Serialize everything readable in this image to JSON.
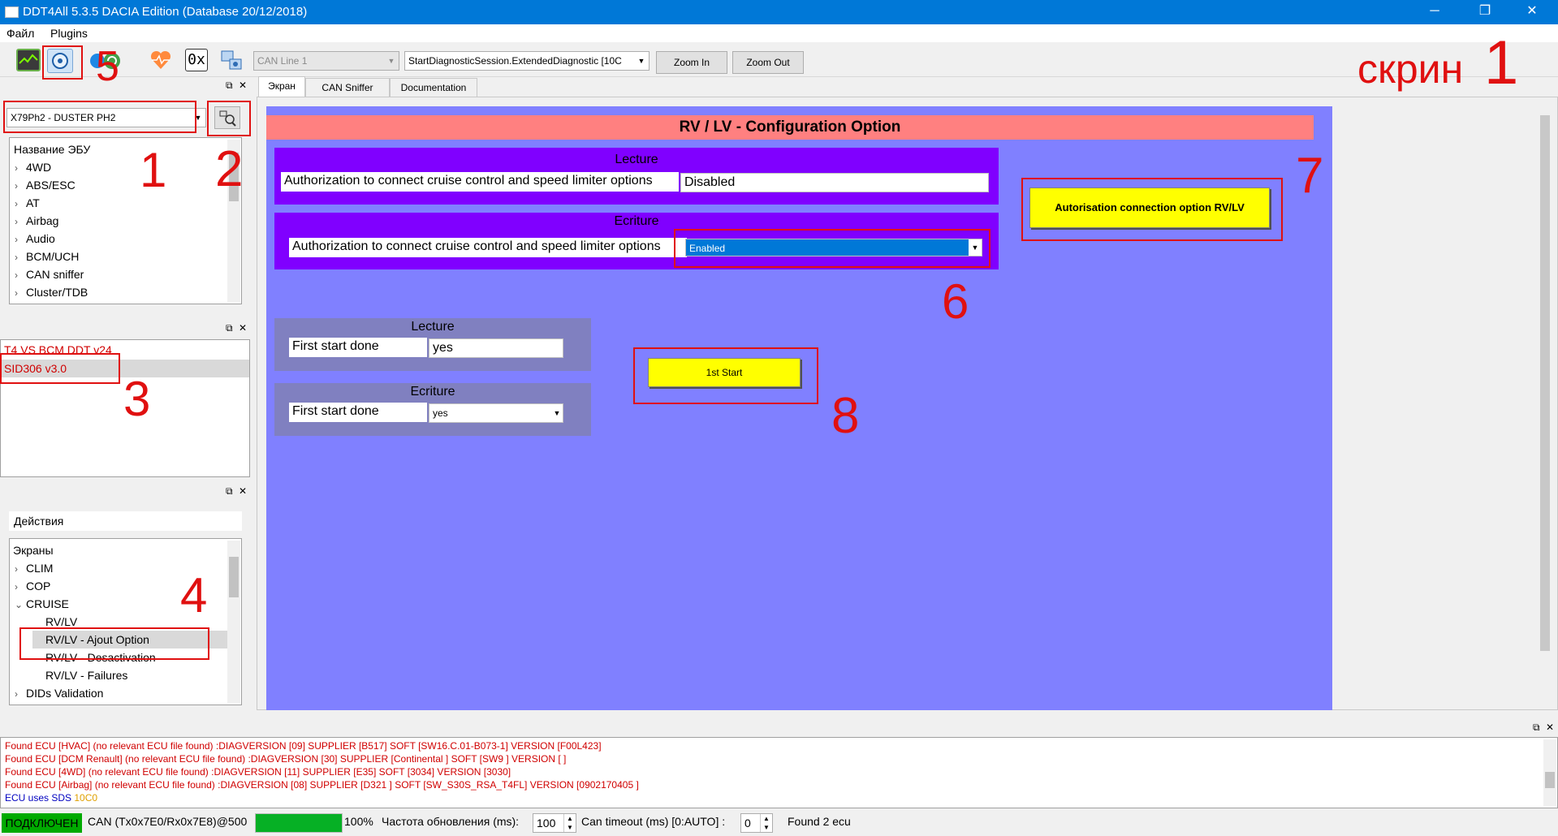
{
  "window": {
    "title": "DDT4All 5.3.5 DACIA Edition (Database 20/12/2018)",
    "minimize": "─",
    "maximize": "❐",
    "close": "✕"
  },
  "menu": {
    "file": "Файл",
    "plugins": "Plugins"
  },
  "toolbar": {
    "can_line": "CAN Line 1",
    "session": "StartDiagnosticSession.ExtendedDiagnostic [10C",
    "zoom_in": "Zoom In",
    "zoom_out": "Zoom Out",
    "hex_icon_text": "0x"
  },
  "vehicle": {
    "selected": "X79Ph2 - DUSTER PH2"
  },
  "ecu_tree": {
    "header": "Название ЭБУ",
    "items": [
      "4WD",
      "ABS/ESC",
      "AT",
      "Airbag",
      "Audio",
      "BCM/UCH",
      "CAN sniffer",
      "Cluster/TDB"
    ]
  },
  "ecu_files": [
    "T4 VS BCM DDT v24",
    "SID306 v3.0"
  ],
  "actions": {
    "header": "Действия"
  },
  "screens_tree": {
    "header": "Экраны",
    "items": [
      {
        "label": "CLIM",
        "chev": "›"
      },
      {
        "label": "COP",
        "chev": "›"
      },
      {
        "label": "CRUISE",
        "chev": "⌄"
      }
    ],
    "children": [
      "RV/LV",
      "RV/LV - Ajout Option",
      "RV/LV - Desactivation",
      "RV/LV - Failures"
    ],
    "after": {
      "label": "DIDs Validation",
      "chev": "›"
    }
  },
  "tabs": [
    "Экран",
    "CAN Sniffer",
    "Documentation"
  ],
  "screen": {
    "title": "RV / LV - Configuration Option",
    "lecture1": {
      "header": "Lecture",
      "label": "Authorization to connect cruise control and speed limiter options",
      "value": "Disabled"
    },
    "ecriture1": {
      "header": "Ecriture",
      "label": "Authorization to connect cruise control and speed limiter options",
      "value": "Enabled"
    },
    "lecture2": {
      "header": "Lecture",
      "label": "First start done",
      "value": "yes"
    },
    "ecriture2": {
      "header": "Ecriture",
      "label": "First start done",
      "value": "yes"
    },
    "btn_rvlv": "Autorisation connection option RV/LV",
    "btn_first": "1st Start"
  },
  "annotations": {
    "screen_label": "скрин",
    "n1": "1",
    "n1b": "1",
    "n2": "2",
    "n3": "3",
    "n4": "4",
    "n5": "5",
    "n6": "6",
    "n7": "7",
    "n8": "8"
  },
  "log": [
    "Found ECU [HVAC] (no relevant ECU file found) :DIAGVERSION [09] SUPPLIER [B517] SOFT [SW16.C.01-B073-1] VERSION [F00L423]",
    "Found ECU [DCM Renault] (no relevant ECU file found) :DIAGVERSION [30] SUPPLIER [Continental ] SOFT [SW9 ] VERSION [ ]",
    "Found ECU [4WD] (no relevant ECU file found) :DIAGVERSION [11] SUPPLIER [E35] SOFT [3034] VERSION [3030]",
    "Found ECU [Airbag] (no relevant ECU file found) :DIAGVERSION [08] SUPPLIER [D321 ] SOFT [SW_S30S_RSA_T4FL] VERSION [0902170405 ]"
  ],
  "log_sds": {
    "text": "ECU uses SDS",
    "code": "10C0"
  },
  "status": {
    "connected": "ПОДКЛЮЧЕН",
    "can": "CAN (Tx0x7E0/Rx0x7E8)@500",
    "progress": 1.0,
    "percent": "100%",
    "refresh_label": "Частота обновления (ms):",
    "refresh_value": "100",
    "timeout_label": "Can timeout (ms) [0:AUTO] :",
    "timeout_value": "0",
    "found": "Found 2 ecu"
  },
  "colors": {
    "titlebar": "#0078d7",
    "screen_bg": "#8080ff",
    "title_strip": "#ff8080",
    "section_bg": "#8000ff",
    "section2_bg": "#8080c0",
    "button_yellow": "#ffff00",
    "annotation_red": "#e01010",
    "connected_green": "#00aa00"
  }
}
